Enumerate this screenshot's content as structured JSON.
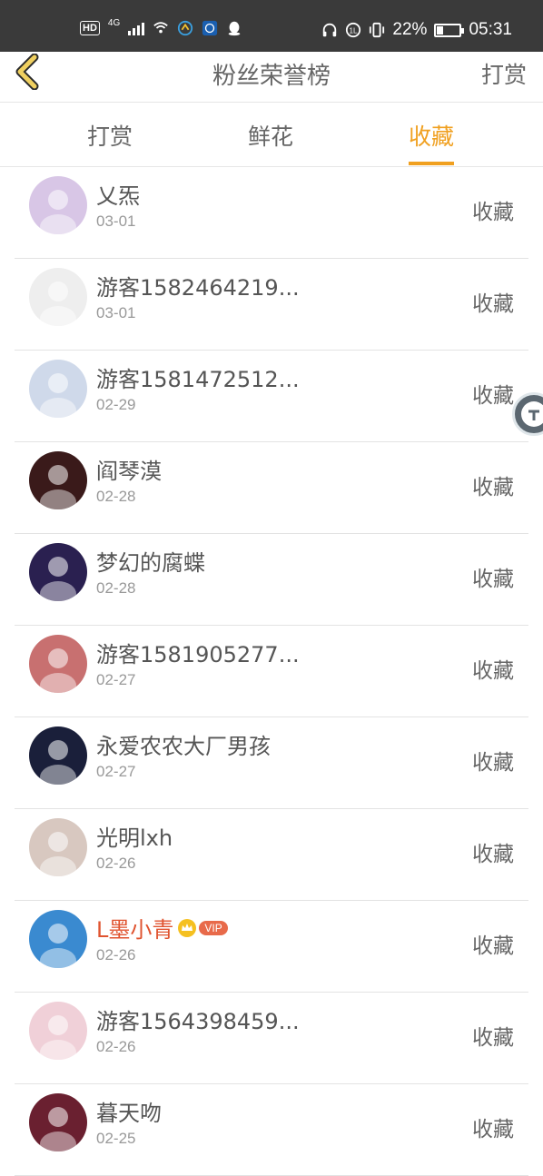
{
  "status_bar": {
    "hd": "HD",
    "network": "4G",
    "battery_percent": "22%",
    "time": "05:31"
  },
  "header": {
    "title": "粉丝荣誉榜",
    "right_link": "打赏"
  },
  "tabs": [
    {
      "label": "打赏",
      "active": false
    },
    {
      "label": "鲜花",
      "active": false
    },
    {
      "label": "收藏",
      "active": true
    }
  ],
  "fans": [
    {
      "name": "乂炁",
      "date": "03-01",
      "action": "收藏",
      "vip": false,
      "avatar_color": "#d8c6e6"
    },
    {
      "name": "游客1582464219...",
      "date": "03-01",
      "action": "收藏",
      "vip": false,
      "avatar_color": "#eeeeee"
    },
    {
      "name": "游客1581472512...",
      "date": "02-29",
      "action": "收藏",
      "vip": false,
      "avatar_color": "#cfd9ea"
    },
    {
      "name": "阎琴漠",
      "date": "02-28",
      "action": "收藏",
      "vip": false,
      "avatar_color": "#3a1a1a"
    },
    {
      "name": "梦幻的腐蝶",
      "date": "02-28",
      "action": "收藏",
      "vip": false,
      "avatar_color": "#2a2050"
    },
    {
      "name": "游客1581905277...",
      "date": "02-27",
      "action": "收藏",
      "vip": false,
      "avatar_color": "#c87070"
    },
    {
      "name": "永爱农农大厂男孩",
      "date": "02-27",
      "action": "收藏",
      "vip": false,
      "avatar_color": "#1a1f3a"
    },
    {
      "name": "光明lxh",
      "date": "02-26",
      "action": "收藏",
      "vip": false,
      "avatar_color": "#d8c8c0"
    },
    {
      "name": "L墨小青",
      "date": "02-26",
      "action": "收藏",
      "vip": true,
      "vip_label": "VIP",
      "avatar_color": "#3a8ad0"
    },
    {
      "name": "游客1564398459...",
      "date": "02-26",
      "action": "收藏",
      "vip": false,
      "avatar_color": "#f0d0d8"
    },
    {
      "name": "暮天吻",
      "date": "02-25",
      "action": "收藏",
      "vip": false,
      "avatar_color": "#6a2030"
    }
  ],
  "colors": {
    "accent": "#f0a020",
    "vip_name": "#e0532f",
    "status_bar_bg": "#3a3a3a"
  }
}
